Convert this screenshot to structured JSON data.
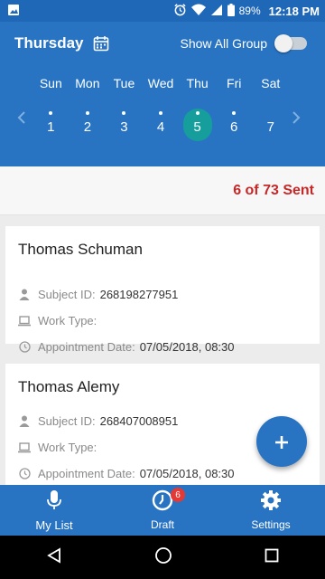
{
  "status_bar": {
    "battery": "89%",
    "time": "12:18 PM"
  },
  "header": {
    "day_title": "Thursday",
    "show_all_label": "Show All Group",
    "weekdays": [
      "Sun",
      "Mon",
      "Tue",
      "Wed",
      "Thu",
      "Fri",
      "Sat"
    ],
    "dates": [
      "1",
      "2",
      "3",
      "4",
      "5",
      "6",
      "7"
    ],
    "selected_date": "5"
  },
  "summary": {
    "sent_text": "6 of 73 Sent"
  },
  "labels": {
    "subject": "Subject ID:",
    "work": "Work Type:",
    "appt": "Appointment Date:"
  },
  "cards": [
    {
      "name": "Thomas Schuman",
      "subject_id": "268198277951",
      "work_type": "",
      "appt_date": "07/05/2018, 08:30"
    },
    {
      "name": "Thomas Alemy",
      "subject_id": "268407008951",
      "work_type": "",
      "appt_date": "07/05/2018, 08:30"
    }
  ],
  "bottom_nav": {
    "my_list": "My List",
    "draft": "Draft",
    "draft_badge": "6",
    "settings": "Settings"
  },
  "colors": {
    "primary": "#2874c3",
    "accent": "#169e9c",
    "sent": "#c62828",
    "badge": "#e53935"
  }
}
